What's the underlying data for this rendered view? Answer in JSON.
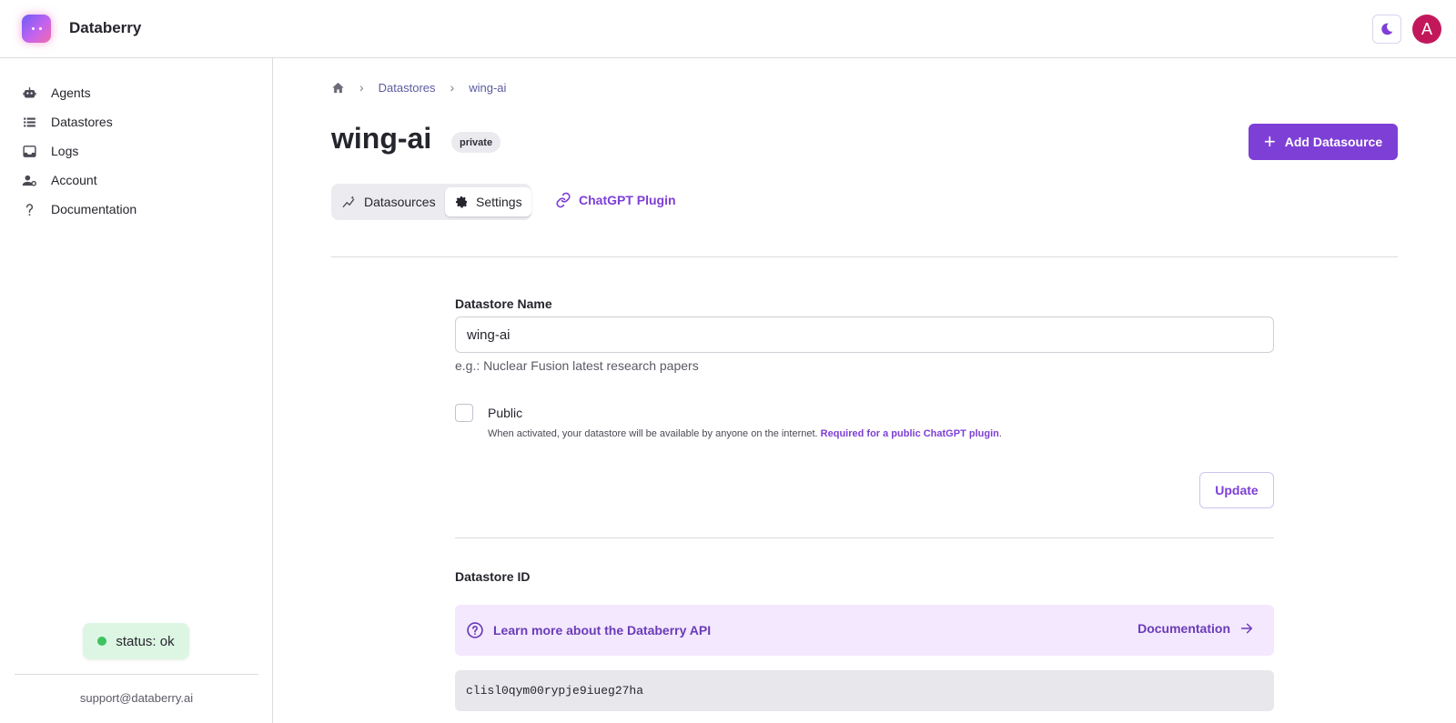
{
  "app": {
    "name": "Databerry"
  },
  "header": {
    "avatar_letter": "A",
    "theme_icon": "moon-icon"
  },
  "sidebar": {
    "items": [
      {
        "label": "Agents",
        "icon": "robot-icon"
      },
      {
        "label": "Datastores",
        "icon": "list-icon"
      },
      {
        "label": "Logs",
        "icon": "inbox-icon"
      },
      {
        "label": "Account",
        "icon": "user-gear-icon"
      },
      {
        "label": "Documentation",
        "icon": "question-icon"
      }
    ],
    "status": "status: ok",
    "support_email": "support@databerry.ai"
  },
  "breadcrumb": {
    "home_icon": "home-icon",
    "items": [
      "Datastores",
      "wing-ai"
    ]
  },
  "page": {
    "title": "wing-ai",
    "badge": "private",
    "add_button": "Add Datasource"
  },
  "tabs": [
    {
      "label": "Datasources",
      "icon": "sparkle-chart-icon",
      "active": false
    },
    {
      "label": "Settings",
      "icon": "gear-icon",
      "active": true
    }
  ],
  "plugin_link": "ChatGPT Plugin",
  "form": {
    "name_label": "Datastore Name",
    "name_value": "wing-ai",
    "name_helper": "e.g.: Nuclear Fusion latest research papers",
    "public_label": "Public",
    "public_desc": "When activated, your datastore will be available by anyone on the internet.",
    "public_link": "Required for a public ChatGPT plugin",
    "public_link_suffix": ".",
    "public_checked": false,
    "update_button": "Update"
  },
  "datastore_id": {
    "label": "Datastore ID",
    "api_text": "Learn more about the Databerry API",
    "doc_link": "Documentation",
    "value": "clisl0qym00rypje9iueg27ha"
  },
  "colors": {
    "accent": "#7e3fd6",
    "status_bg": "#ddf6e3",
    "avatar": "#c2185b"
  }
}
